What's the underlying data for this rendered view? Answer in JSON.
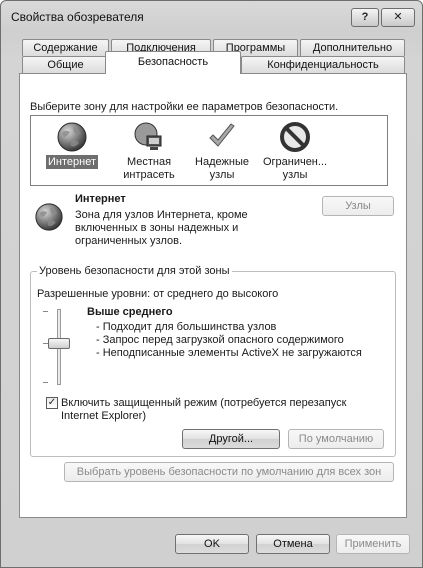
{
  "window": {
    "title": "Свойства обозревателя",
    "help_label": "?",
    "close_label": "✕"
  },
  "tabs": {
    "row_top": [
      "Содержание",
      "Подключения",
      "Программы",
      "Дополнительно"
    ],
    "row_bottom": [
      "Общие",
      "Безопасность",
      "Конфиденциальность"
    ],
    "active": "Безопасность"
  },
  "zones": {
    "prompt": "Выберите зону для настройки ее параметров безопасности.",
    "items": [
      {
        "label": "Интернет",
        "icon": "globe-icon",
        "selected": true
      },
      {
        "label": "Местная\nинтрасеть",
        "icon": "intranet-icon",
        "selected": false
      },
      {
        "label": "Надежные\nузлы",
        "icon": "checkmark-icon",
        "selected": false
      },
      {
        "label": "Ограничен...\nузлы",
        "icon": "no-entry-icon",
        "selected": false
      }
    ]
  },
  "zone_info": {
    "title": "Интернет",
    "description": "Зона для узлов Интернета, кроме включенных в зоны надежных и ограниченных узлов.",
    "sites_button": "Узлы"
  },
  "security_level": {
    "group_title": "Уровень безопасности для этой зоны",
    "allowed": "Разрешенные уровни: от среднего до высокого",
    "level_name": "Выше среднего",
    "level_fraction": 0.5,
    "details": [
      "- Подходит для большинства узлов",
      "- Запрос перед загрузкой опасного содержимого",
      "- Неподписанные элементы ActiveX не загружаются"
    ],
    "protected_mode_label": "Включить защищенный режим (потребуется перезапуск Internet Explorer)",
    "protected_mode_checked": true,
    "custom_button": "Другой...",
    "default_button": "По умолчанию"
  },
  "reset_all_button": "Выбрать уровень безопасности по умолчанию для всех зон",
  "footer": {
    "ok": "OK",
    "cancel": "Отмена",
    "apply": "Применить"
  }
}
